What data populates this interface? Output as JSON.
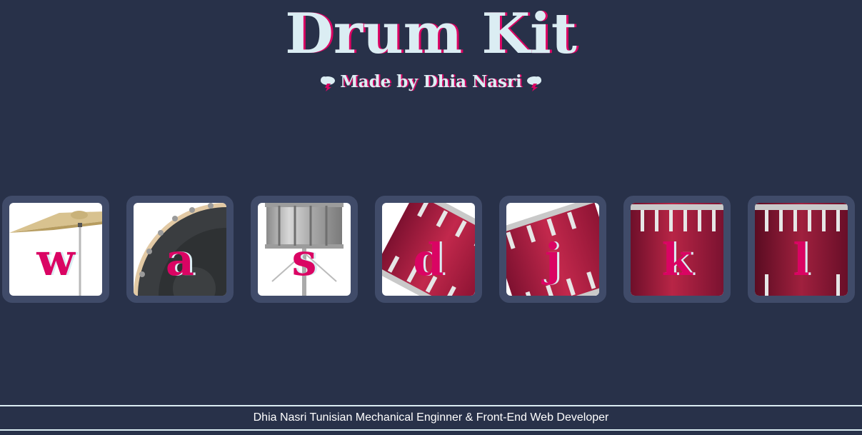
{
  "header": {
    "title": "Drum Kit",
    "subtitle": "Made by Dhia Nasri",
    "left_icon": "thunder-cloud-icon",
    "right_icon": "thunder-cloud-icon"
  },
  "drums": [
    {
      "key": "w",
      "art": "crash-cymbal"
    },
    {
      "key": "a",
      "art": "kick-drum"
    },
    {
      "key": "s",
      "art": "snare-drum"
    },
    {
      "key": "d",
      "art": "tom-1"
    },
    {
      "key": "j",
      "art": "tom-2"
    },
    {
      "key": "k",
      "art": "tom-3"
    },
    {
      "key": "l",
      "art": "tom-4"
    }
  ],
  "footer": {
    "text": "Dhia Nasri Tunisian Mechanical Enginner & Front-End Web Developer"
  },
  "colors": {
    "background": "#283149",
    "button_frame": "#404b69",
    "accent": "#da0463",
    "title_text": "#dbedf3"
  }
}
